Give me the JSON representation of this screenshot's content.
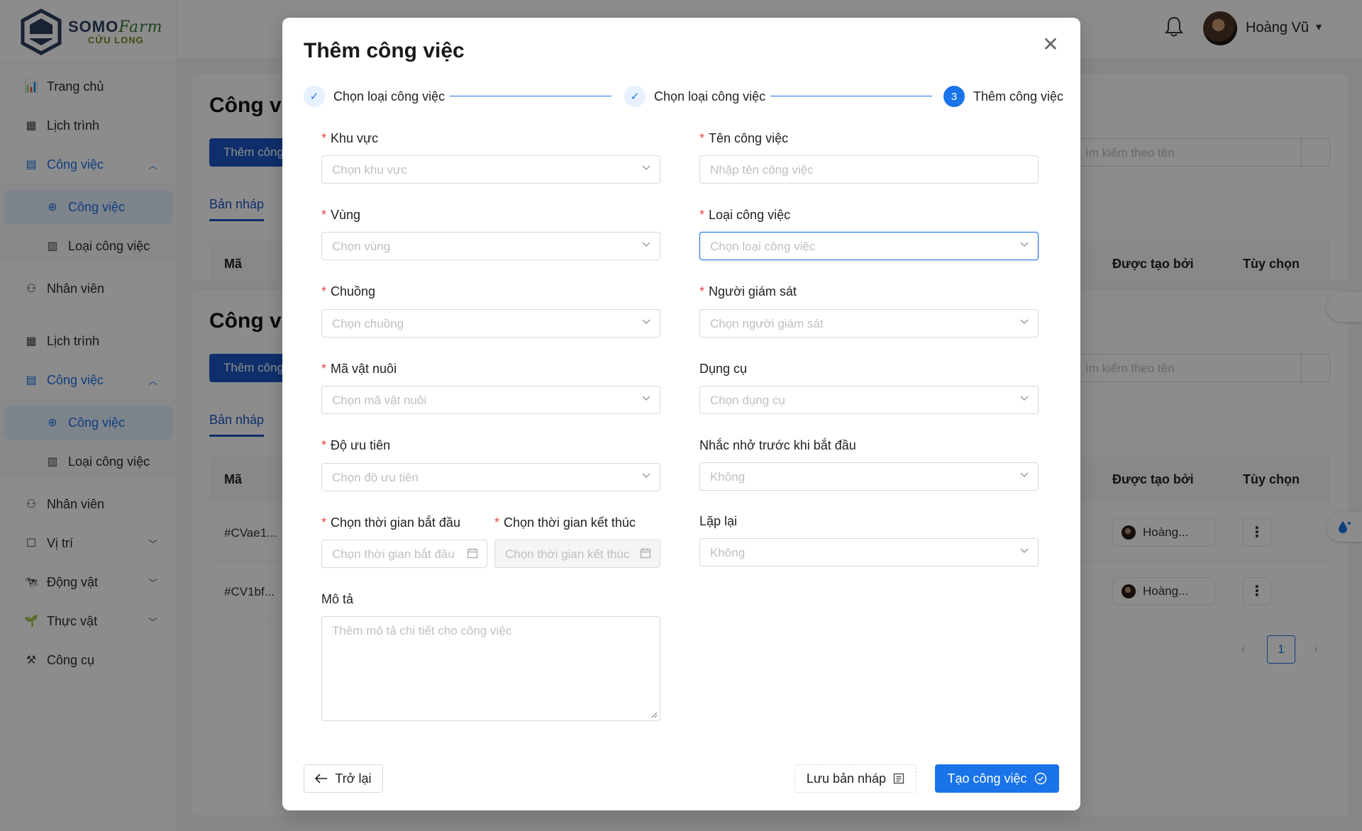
{
  "app": {
    "logo_line1": "SOMO",
    "logo_line1_italic": "Farm",
    "logo_line2": "CỬU LONG"
  },
  "sidebar": {
    "items": [
      {
        "label": "Trang chủ",
        "icon": "bar-chart-icon"
      },
      {
        "label": "Lịch trình",
        "icon": "calendar-icon"
      },
      {
        "label": "Công việc",
        "icon": "document-icon"
      },
      {
        "label": "Công việc",
        "icon": "target-icon"
      },
      {
        "label": "Loại công việc",
        "icon": "task-list-icon"
      },
      {
        "label": "Nhân viên",
        "icon": "employee-icon"
      },
      {
        "label": "Lịch trình",
        "icon": "calendar-icon"
      },
      {
        "label": "Công việc",
        "icon": "document-icon"
      },
      {
        "label": "Công việc",
        "icon": "target-icon"
      },
      {
        "label": "Loại công việc",
        "icon": "task-list-icon"
      },
      {
        "label": "Nhân viên",
        "icon": "employee-icon"
      },
      {
        "label": "Vị trí",
        "icon": "square-icon"
      },
      {
        "label": "Động vật",
        "icon": "animal-icon"
      },
      {
        "label": "Thực vật",
        "icon": "plant-icon"
      },
      {
        "label": "Công cụ",
        "icon": "paint-roller-icon"
      }
    ],
    "overlap_text": "Trang chủ"
  },
  "header": {
    "username": "Hoàng Vũ"
  },
  "background": {
    "page_title": "Công vi",
    "add_button": "Thêm công",
    "tab_draft": "Bản nháp",
    "col_code": "Mã",
    "col_created_by": "Được tạo bởi",
    "col_options": "Tùy chọn",
    "search_placeholder": "ìm kiếm theo tên",
    "rows": [
      {
        "code": "#CVae1...",
        "creator": "Hoàng..."
      },
      {
        "code": "#CV1bf...",
        "creator": "Hoàng..."
      }
    ],
    "page_number": "1"
  },
  "modal": {
    "title": "Thêm công việc",
    "steps": [
      {
        "label": "Chọn loại công việc",
        "status": "done"
      },
      {
        "label": "Chọn loại công việc",
        "status": "done"
      },
      {
        "label": "Thêm công việc",
        "status": "current",
        "number": "3"
      }
    ],
    "fields": {
      "area": {
        "label": "Khu vực",
        "placeholder": "Chọn khu vực",
        "required": true
      },
      "task_name": {
        "label": "Tên công việc",
        "placeholder": "Nhập tên công việc",
        "required": true
      },
      "zone": {
        "label": "Vùng",
        "placeholder": "Chọn vùng",
        "required": true
      },
      "task_type": {
        "label": "Loại công việc",
        "placeholder": "Chọn loại công việc",
        "required": true
      },
      "barn": {
        "label": "Chuồng",
        "placeholder": "Chọn chuồng",
        "required": true
      },
      "supervisor": {
        "label": "Người giám sát",
        "placeholder": "Chọn người giám sát",
        "required": true
      },
      "animal_code": {
        "label": "Mã vật nuôi",
        "placeholder": "Chọn mã vật nuôi",
        "required": true
      },
      "tools": {
        "label": "Dụng cụ",
        "placeholder": "Chọn dụng cụ",
        "required": false
      },
      "priority": {
        "label": "Độ ưu tiên",
        "placeholder": "Chọn độ ưu tiên",
        "required": true
      },
      "reminder": {
        "label": "Nhắc nhở trước khi bắt đầu",
        "value": "Không",
        "required": false
      },
      "start_time": {
        "label": "Chọn thời gian bắt đầu",
        "placeholder": "Chọn thời gian bắt đầu",
        "required": true
      },
      "end_time": {
        "label": "Chọn thời gian kết thúc",
        "placeholder": "Chọn thời gian kết thúc",
        "required": true
      },
      "repeat": {
        "label": "Lặp lại",
        "value": "Không",
        "required": false
      },
      "description": {
        "label": "Mô tả",
        "placeholder": "Thêm mô tả chi tiết cho công việc"
      }
    },
    "buttons": {
      "back": "Trở lại",
      "save_draft": "Lưu bản nháp",
      "create": "Tạo công việc"
    }
  },
  "colors": {
    "primary": "#1a73e8",
    "required": "#e54545",
    "brand_dark": "#2c3e5c",
    "brand_green": "#6b8e23"
  }
}
